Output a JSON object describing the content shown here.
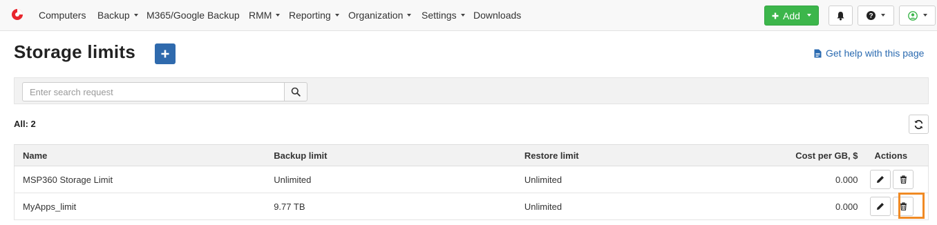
{
  "nav": {
    "items": [
      {
        "label": "Computers",
        "dropdown": false
      },
      {
        "label": "Backup",
        "dropdown": true
      },
      {
        "label": "M365/Google Backup",
        "dropdown": false
      },
      {
        "label": "RMM",
        "dropdown": true
      },
      {
        "label": "Reporting",
        "dropdown": true
      },
      {
        "label": "Organization",
        "dropdown": true
      },
      {
        "label": "Settings",
        "dropdown": true
      },
      {
        "label": "Downloads",
        "dropdown": false
      }
    ],
    "add_label": "Add",
    "icons": {
      "logo": "brand-logo-icon",
      "bell": "bell-icon",
      "help": "question-circle-icon",
      "user": "user-circle-icon"
    },
    "colors": {
      "add_button": "#3cb64b",
      "user_icon": "#3cb64b"
    }
  },
  "page": {
    "title": "Storage limits",
    "help_link": "Get help with this page",
    "accent": "#2f6aad"
  },
  "search": {
    "placeholder": "Enter search request",
    "value": ""
  },
  "summary": {
    "count_label": "All: 2"
  },
  "table": {
    "headers": {
      "name": "Name",
      "backup_limit": "Backup limit",
      "restore_limit": "Restore limit",
      "cost": "Cost per GB, $",
      "actions": "Actions"
    },
    "rows": [
      {
        "name": "MSP360 Storage Limit",
        "backup_limit": "Unlimited",
        "restore_limit": "Unlimited",
        "cost": "0.000"
      },
      {
        "name": "MyApps_limit",
        "backup_limit": "9.77 TB",
        "restore_limit": "Unlimited",
        "cost": "0.000"
      }
    ],
    "row_actions": [
      "edit-icon",
      "trash-icon"
    ]
  },
  "highlight": {
    "color": "#f08a24",
    "target": "delete-button-row-2"
  }
}
